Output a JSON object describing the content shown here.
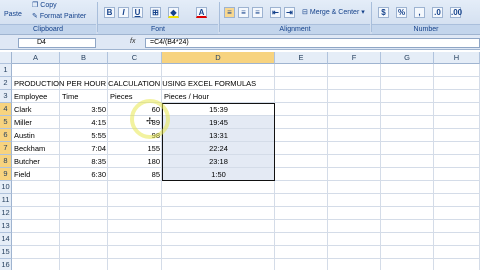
{
  "ribbon": {
    "copy_label": "Copy",
    "paste_label": "Paste",
    "format_painter_label": "Format Painter",
    "clipboard_label": "Clipboard",
    "font_label": "Font",
    "alignment_label": "Alignment",
    "number_label": "Number",
    "merge_center_label": "Merge & Center",
    "currency_symbol": "$",
    "percent_symbol": "%",
    "bold": "B",
    "italic": "I",
    "underline": "U"
  },
  "formula_bar": {
    "name_box": "D4",
    "fx": "fx",
    "formula": "=C4/(B4*24)"
  },
  "columns": [
    "A",
    "B",
    "C",
    "D",
    "E",
    "F",
    "G",
    "H"
  ],
  "rows": [
    "1",
    "2",
    "3",
    "4",
    "5",
    "6",
    "7",
    "8",
    "9",
    "10",
    "11",
    "12",
    "13",
    "14",
    "15",
    "16"
  ],
  "sheet": {
    "title": "PRODUCTION PER HOUR CALCULATION USING EXCEL FORMULAS",
    "headers": {
      "employee": "Employee",
      "time": "Time",
      "pieces": "Pieces",
      "pieces_hour": "Pieces / Hour"
    },
    "data_rows": [
      {
        "employee": "Clark",
        "time": "3:50",
        "pieces": "60",
        "rate": "15:39"
      },
      {
        "employee": "Miller",
        "time": "4:15",
        "pieces": "89",
        "rate": "19:45"
      },
      {
        "employee": "Austin",
        "time": "5:55",
        "pieces": "98",
        "rate": "13:31"
      },
      {
        "employee": "Beckham",
        "time": "7:04",
        "pieces": "155",
        "rate": "22:24"
      },
      {
        "employee": "Butcher",
        "time": "8:35",
        "pieces": "180",
        "rate": "23:18"
      },
      {
        "employee": "Field",
        "time": "6:30",
        "pieces": "85",
        "rate": "1:50"
      }
    ]
  },
  "colors": {
    "selected_header": "#f7d37f",
    "selection_fill": "#e4eaf4",
    "ribbon_text": "#15428b"
  }
}
